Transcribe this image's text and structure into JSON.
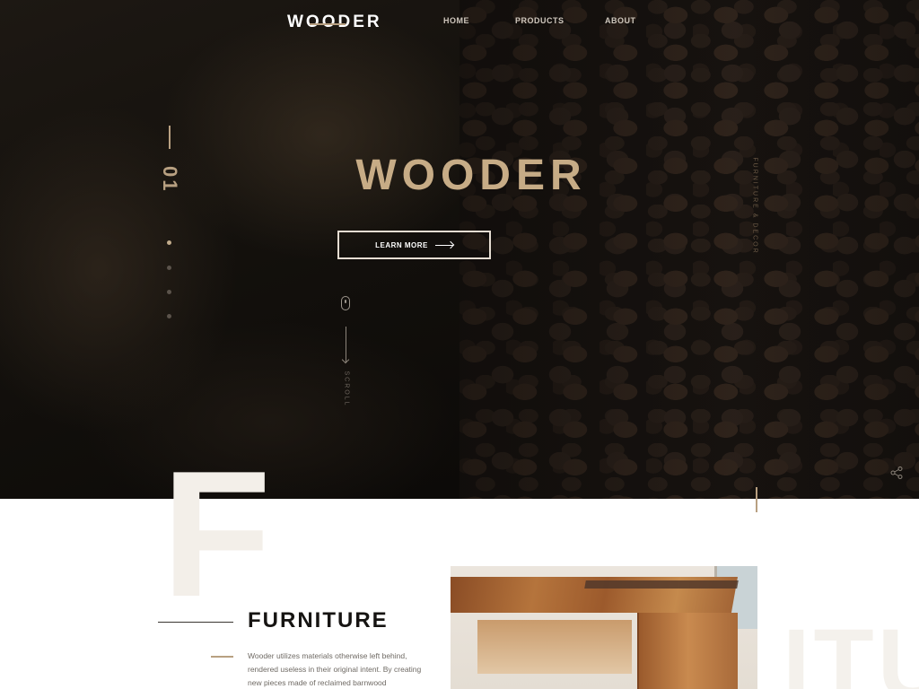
{
  "brand": {
    "logo_text": "WOODER"
  },
  "nav": {
    "items": [
      {
        "label": "HOME"
      },
      {
        "label": "PRODUCTS"
      },
      {
        "label": "ABOUT"
      }
    ]
  },
  "hero": {
    "slide_number": "01",
    "headline": "WOODER",
    "cta_label": "LEARN MORE",
    "scroll_label": "SCROLL",
    "vertical_tagline": "FURNITURE & DECOR",
    "slides_total": 4,
    "slide_active": 1,
    "bg_letter": "F"
  },
  "section": {
    "title": "FURNITURE",
    "body": "Wooder utilizes materials otherwise left behind, rendered useless in their original intent. By creating new pieces made of reclaimed barnwood",
    "bg_text": "ITU"
  },
  "colors": {
    "accent": "#c7ac86",
    "gold": "#b8a081",
    "dark": "#0d0b09",
    "text_dark": "#161412"
  },
  "icons": {
    "share": "share-icon",
    "mouse": "mouse-icon",
    "arrow": "arrow-right-icon"
  }
}
